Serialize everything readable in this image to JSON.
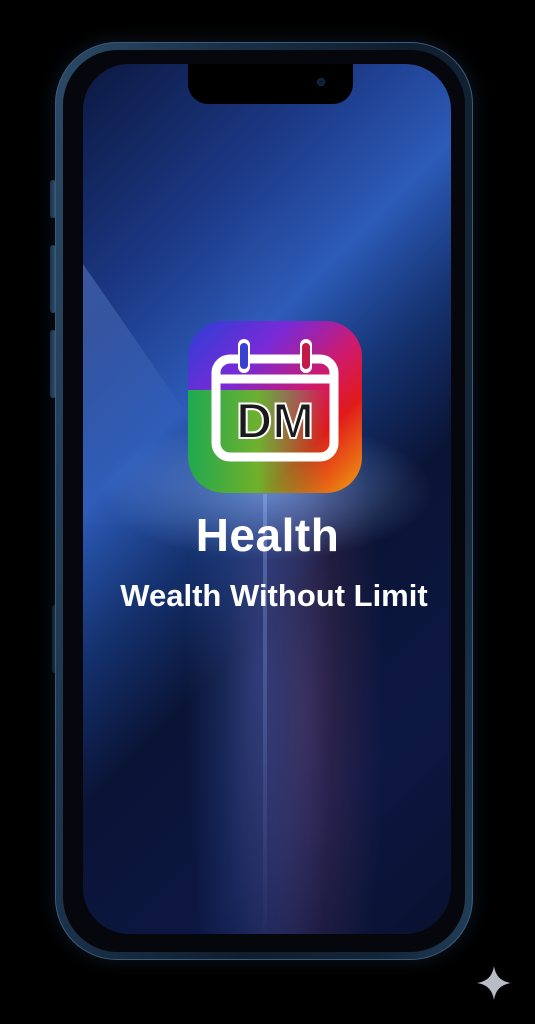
{
  "app": {
    "icon_text": "DM",
    "title": "Health",
    "tagline": "Wealth Without Limit"
  },
  "icons": {
    "app_icon": "calendar-icon",
    "watermark": "sparkle-icon"
  },
  "colors": {
    "background": "#000000",
    "text": "#ffffff",
    "icon_gradient": [
      "#2a3fd6",
      "#7a2ad6",
      "#d01a6a",
      "#e01a1a",
      "#f0a010",
      "#1ab04a"
    ]
  }
}
